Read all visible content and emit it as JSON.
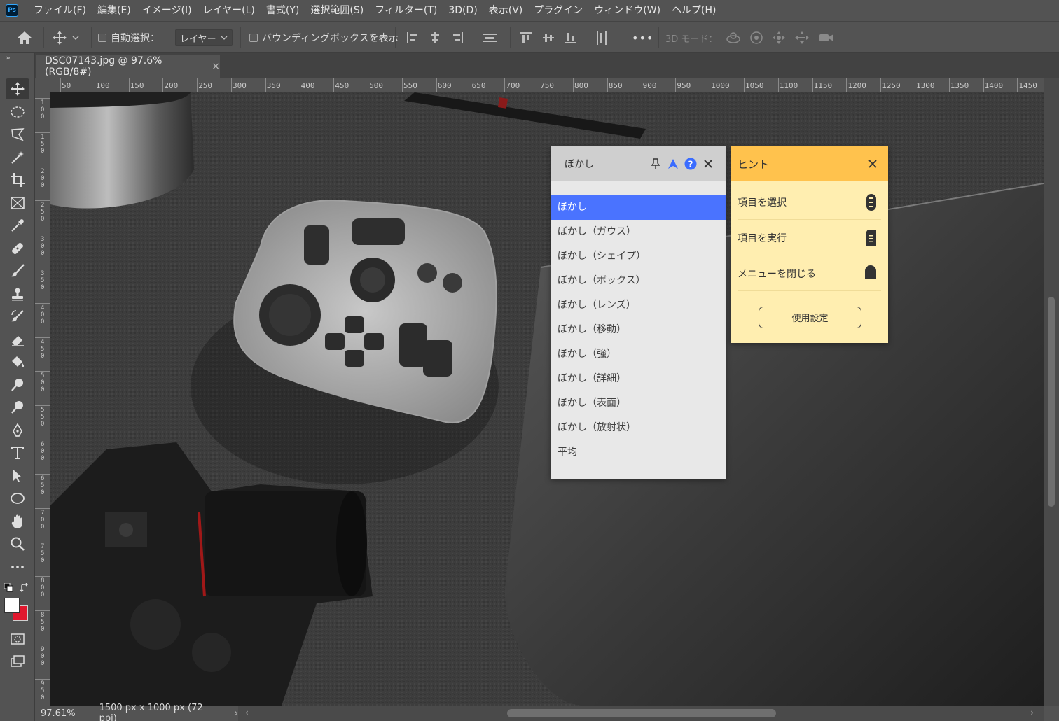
{
  "app": {
    "logo_text": "Ps"
  },
  "menu": [
    "ファイル(F)",
    "編集(E)",
    "イメージ(I)",
    "レイヤー(L)",
    "書式(Y)",
    "選択範囲(S)",
    "フィルター(T)",
    "3D(D)",
    "表示(V)",
    "プラグイン",
    "ウィンドウ(W)",
    "ヘルプ(H)"
  ],
  "options": {
    "auto_select_label": "自動選択：",
    "layer_dropdown_value": "レイヤー",
    "bounding_box_label": "バウンディングボックスを表示",
    "mode_3d_label": "3D モード：",
    "more": "•••"
  },
  "document": {
    "tab_title": "DSC07143.jpg @ 97.6% (RGB/8#)",
    "tab_close": "×",
    "zoom": "97.61%",
    "dimensions": "1500 px x 1000 px (72 ppi)",
    "status_arrow": "›"
  },
  "ruler": {
    "top_labels": [
      "50",
      "100",
      "150",
      "200",
      "250",
      "300",
      "350",
      "400",
      "450",
      "500",
      "550",
      "600",
      "650",
      "700",
      "750",
      "800",
      "850",
      "900",
      "950",
      "1000",
      "1050",
      "1100",
      "1150",
      "1200",
      "1250",
      "1300",
      "1350",
      "1400",
      "1450"
    ],
    "left_labels": [
      "100",
      "150",
      "200",
      "250",
      "300",
      "350",
      "400",
      "450",
      "500",
      "550",
      "600",
      "650",
      "700",
      "750",
      "800",
      "850",
      "900",
      "950"
    ]
  },
  "blur_panel": {
    "title": "ぼかし",
    "help": "?",
    "items": [
      "ぼかし",
      "ぼかし（ガウス）",
      "ぼかし（シェイプ）",
      "ぼかし（ボックス）",
      "ぼかし（レンズ）",
      "ぼかし（移動）",
      "ぼかし（強）",
      "ぼかし（詳細）",
      "ぼかし（表面）",
      "ぼかし（放射状）",
      "平均"
    ],
    "selected_index": 0,
    "selected_color": "#4a73ff"
  },
  "hint_panel": {
    "title": "ヒント",
    "rows": [
      {
        "label": "項目を選択",
        "icon": "dial-icon"
      },
      {
        "label": "項目を実行",
        "icon": "button-icon"
      },
      {
        "label": "メニューを閉じる",
        "icon": "key-icon"
      }
    ],
    "settings_button": "使用設定",
    "header_color": "#ffc24d",
    "body_color": "#ffeeb0"
  }
}
